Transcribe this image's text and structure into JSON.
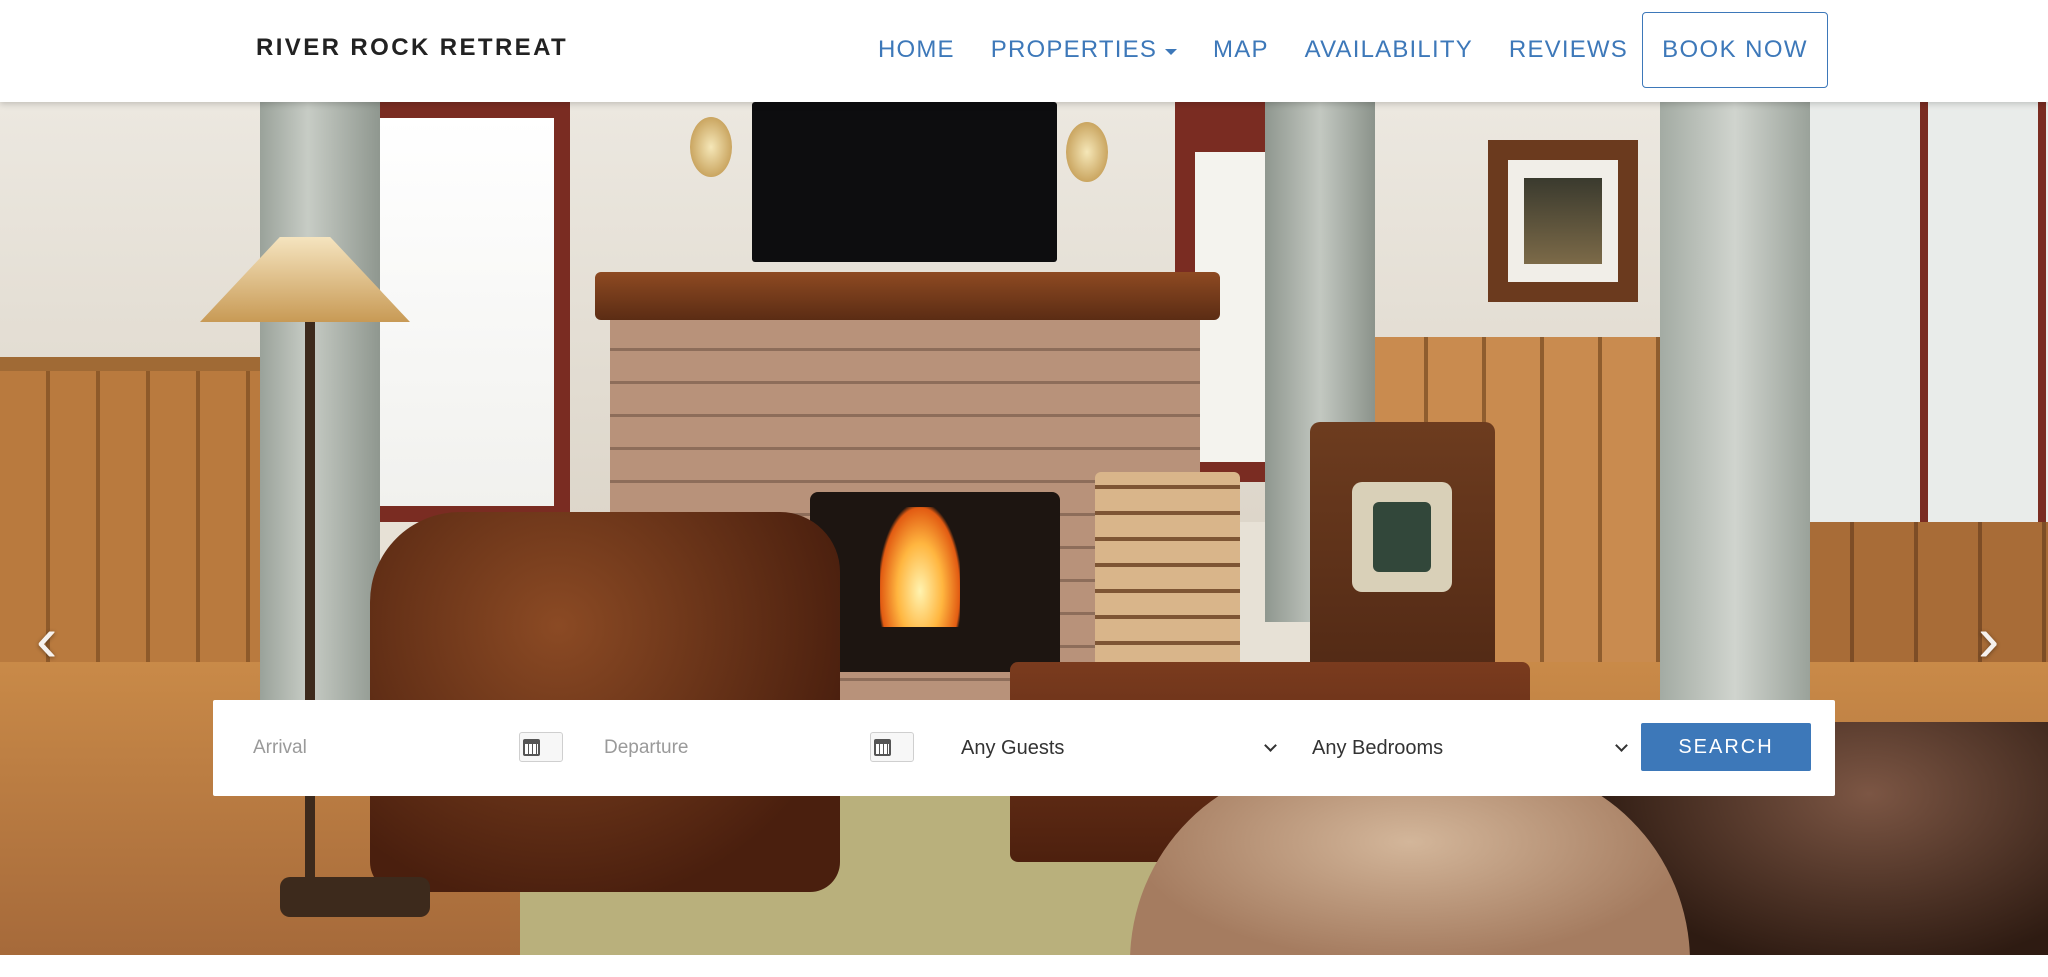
{
  "header": {
    "brand": "RIVER ROCK RETREAT",
    "nav": [
      {
        "label": "HOME"
      },
      {
        "label": "PROPERTIES",
        "has_dropdown": true
      },
      {
        "label": "MAP"
      },
      {
        "label": "AVAILABILITY"
      },
      {
        "label": "REVIEWS"
      }
    ],
    "book_now": "BOOK NOW"
  },
  "hero": {
    "image_description": "Cabin living room with stone fireplace, leather armchair and floor lamp",
    "prev_icon": "chevron-left-icon",
    "next_icon": "chevron-right-icon"
  },
  "search": {
    "arrival_placeholder": "Arrival",
    "departure_placeholder": "Departure",
    "calendar_icon": "calendar-icon",
    "guests": "Any Guests",
    "bedrooms": "Any Bedrooms",
    "button": "SEARCH"
  },
  "colors": {
    "accent": "#3d78b9",
    "brand_text": "#222222",
    "placeholder": "#9a9a9a"
  }
}
